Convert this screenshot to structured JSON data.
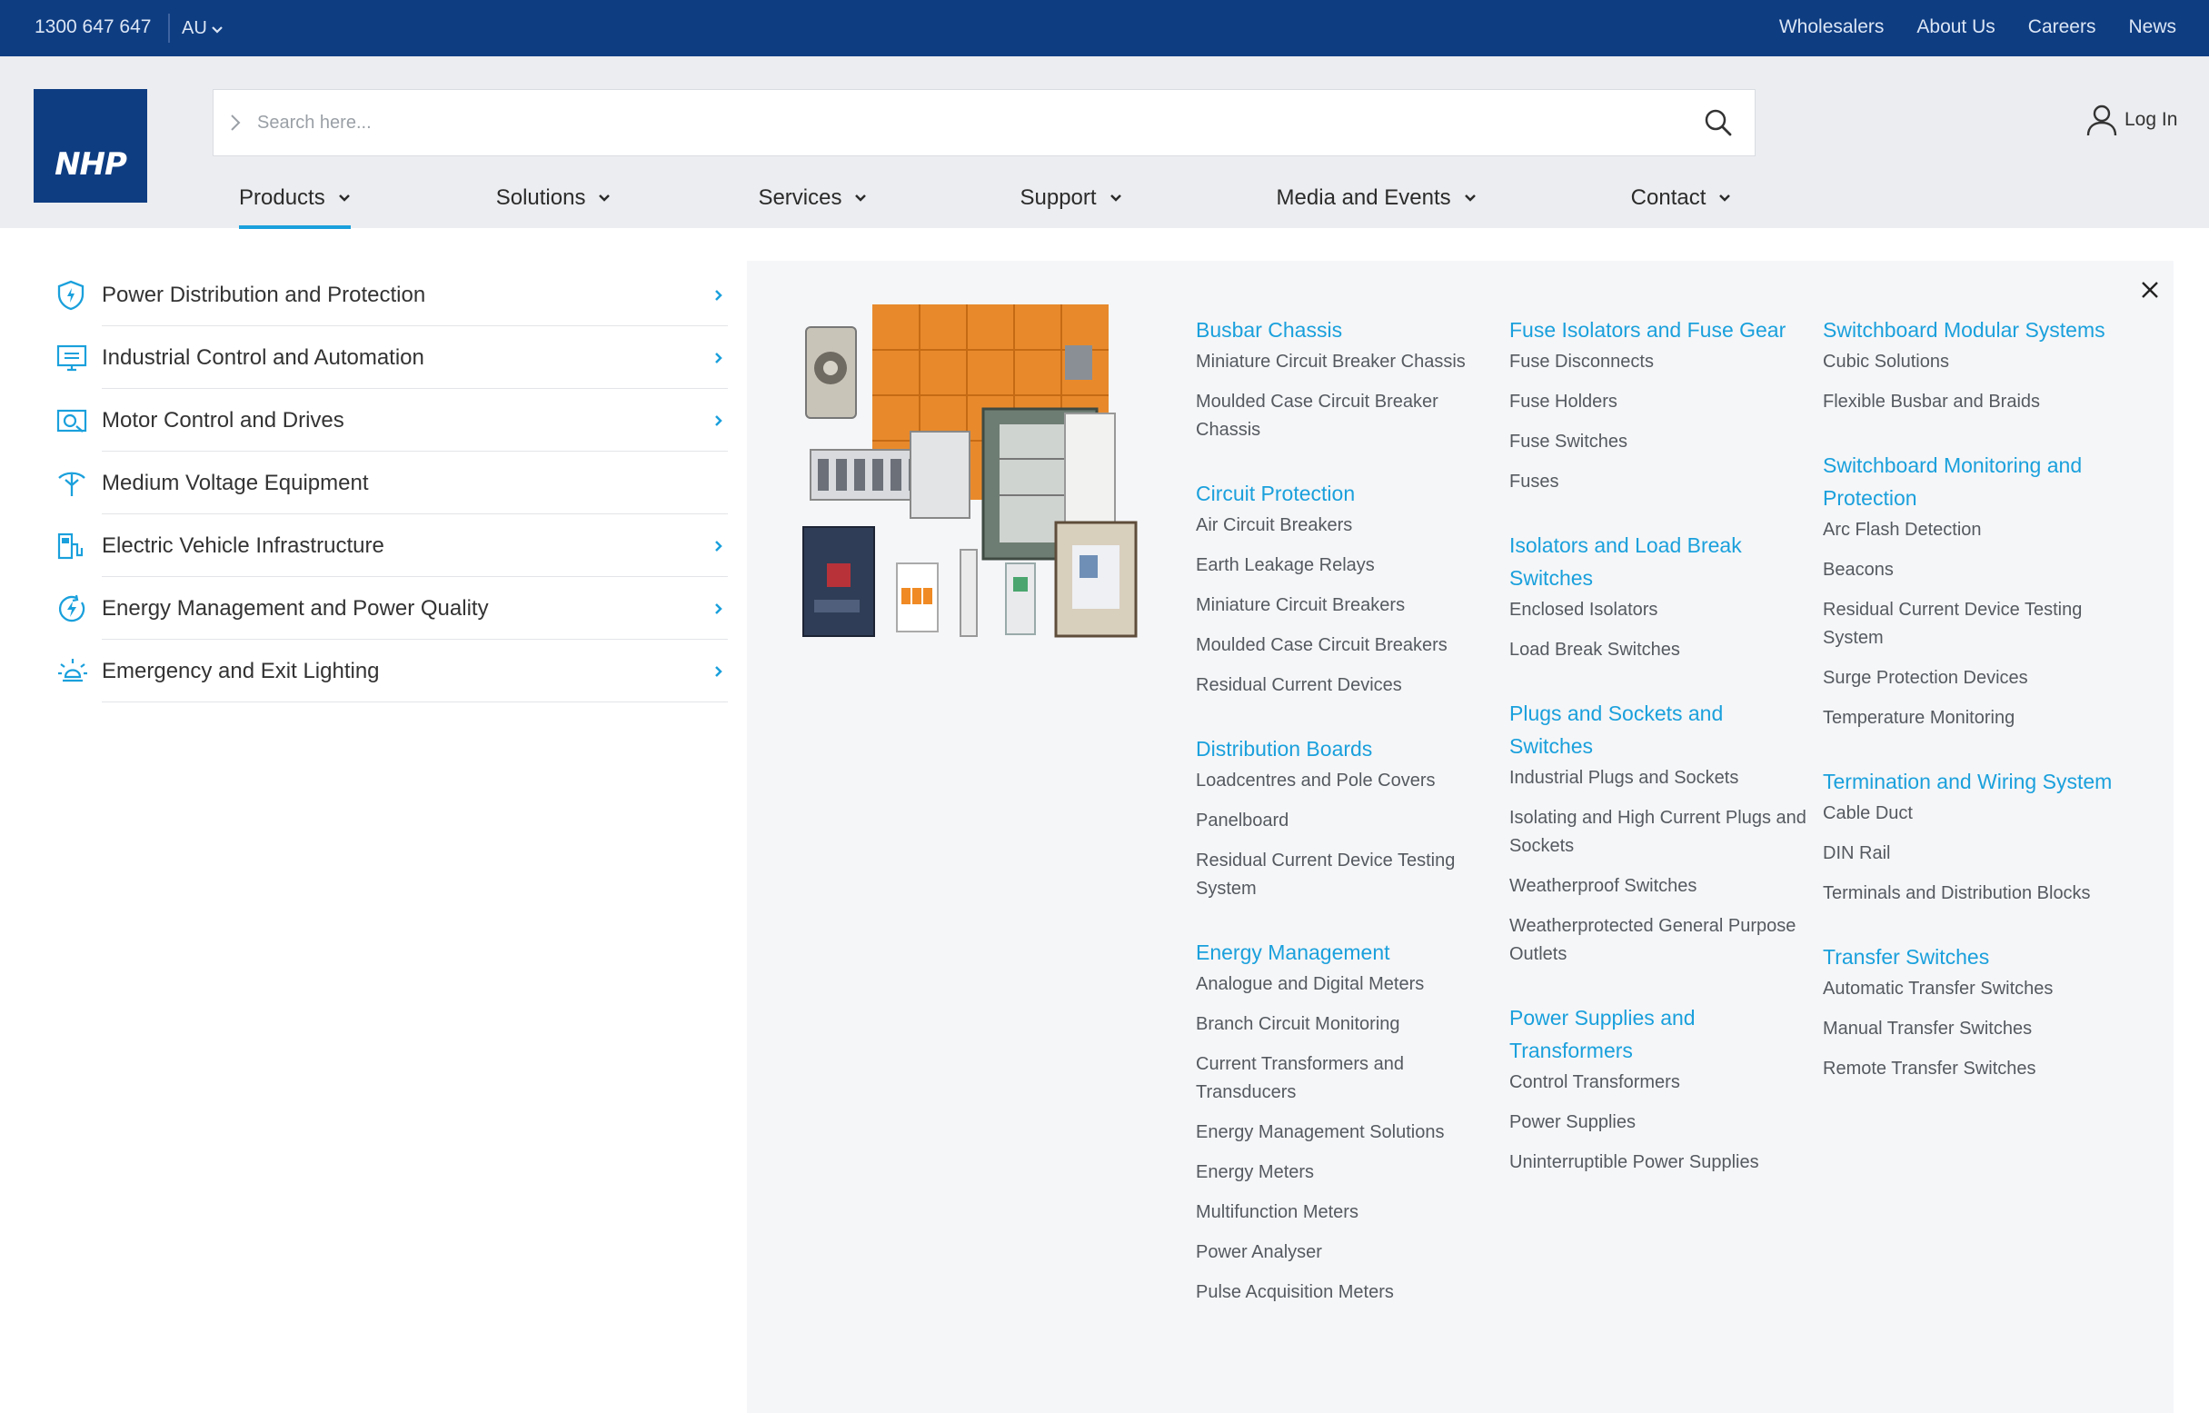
{
  "topbar": {
    "phone": "1300 647 647",
    "region": "AU",
    "links": [
      "Wholesalers",
      "About Us",
      "Careers",
      "News"
    ]
  },
  "brand": {
    "logo_text": "NHP",
    "color": "#0f3d82",
    "accent": "#1aa0dc"
  },
  "search": {
    "placeholder": "Search here..."
  },
  "account": {
    "login_label": "Log In"
  },
  "nav": [
    {
      "label": "Products",
      "active": true
    },
    {
      "label": "Solutions"
    },
    {
      "label": "Services"
    },
    {
      "label": "Support"
    },
    {
      "label": "Media and Events"
    },
    {
      "label": "Contact"
    }
  ],
  "categories": [
    {
      "label": "Power Distribution and Protection",
      "icon": "shield-icon",
      "arrow": true
    },
    {
      "label": "Industrial Control and Automation",
      "icon": "control-panel-icon",
      "arrow": true
    },
    {
      "label": "Motor Control and Drives",
      "icon": "motor-icon",
      "arrow": true
    },
    {
      "label": "Medium Voltage Equipment",
      "icon": "pylon-icon",
      "arrow": false
    },
    {
      "label": "Electric Vehicle Infrastructure",
      "icon": "ev-charger-icon",
      "arrow": true
    },
    {
      "label": "Energy Management and Power Quality",
      "icon": "energy-bolt-icon",
      "arrow": true
    },
    {
      "label": "Emergency and Exit Lighting",
      "icon": "emergency-light-icon",
      "arrow": true
    }
  ],
  "columns": [
    [
      {
        "title": "Busbar Chassis",
        "items": [
          "Miniature Circuit Breaker Chassis",
          "Moulded Case Circuit Breaker Chassis"
        ]
      },
      {
        "title": "Circuit Protection",
        "items": [
          "Air Circuit Breakers",
          "Earth Leakage Relays",
          "Miniature Circuit Breakers",
          "Moulded Case Circuit Breakers",
          "Residual Current Devices"
        ]
      },
      {
        "title": "Distribution Boards",
        "items": [
          "Loadcentres and Pole Covers",
          "Panelboard",
          "Residual Current Device Testing System"
        ]
      },
      {
        "title": "Energy Management",
        "items": [
          "Analogue and Digital Meters",
          "Branch Circuit Monitoring",
          "Current Transformers and Transducers",
          "Energy Management Solutions",
          "Energy Meters",
          "Multifunction Meters",
          "Power Analyser",
          "Pulse Acquisition Meters"
        ]
      }
    ],
    [
      {
        "title": "Fuse Isolators and Fuse Gear",
        "items": [
          "Fuse Disconnects",
          "Fuse Holders",
          "Fuse Switches",
          "Fuses"
        ]
      },
      {
        "title": "Isolators and Load Break Switches",
        "items": [
          "Enclosed Isolators",
          "Load Break Switches"
        ]
      },
      {
        "title": "Plugs and Sockets and Switches",
        "items": [
          "Industrial Plugs and Sockets",
          "Isolating and High Current Plugs and Sockets",
          "Weatherproof Switches",
          "Weatherprotected General Purpose Outlets"
        ]
      },
      {
        "title": "Power Supplies and Transformers",
        "items": [
          "Control Transformers",
          "Power Supplies",
          "Uninterruptible Power Supplies"
        ]
      }
    ],
    [
      {
        "title": "Switchboard Modular Systems",
        "items": [
          "Cubic Solutions",
          "Flexible Busbar and Braids"
        ]
      },
      {
        "title": "Switchboard Monitoring and Protection",
        "items": [
          "Arc Flash Detection",
          "Beacons",
          "Residual Current Device Testing System",
          "Surge Protection Devices",
          "Temperature Monitoring"
        ]
      },
      {
        "title": "Termination and Wiring System",
        "items": [
          "Cable Duct",
          "DIN Rail",
          "Terminals and Distribution Blocks"
        ]
      },
      {
        "title": "Transfer Switches",
        "items": [
          "Automatic Transfer Switches",
          "Manual Transfer Switches",
          "Remote Transfer Switches"
        ]
      }
    ]
  ]
}
